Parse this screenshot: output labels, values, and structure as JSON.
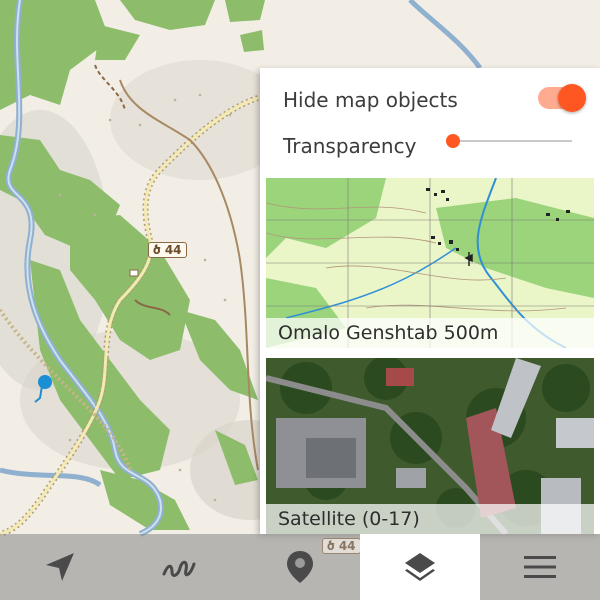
{
  "map": {
    "road_badge_text": "ծ 44",
    "road_badge_bottom_text": "ծ 44"
  },
  "panel": {
    "hide_objects_label": "Hide map objects",
    "hide_objects_enabled": true,
    "transparency_label": "Transparency",
    "transparency_value": 0.0,
    "accent_color": "#ff5722",
    "layers": [
      {
        "name": "Omalo Genshtab 500m",
        "kind": "topographic"
      },
      {
        "name": "Satellite (0-17)",
        "kind": "satellite"
      }
    ]
  },
  "bottom_nav": {
    "items": [
      {
        "name": "navigate",
        "icon": "navigation-arrow-icon",
        "active": false
      },
      {
        "name": "tracks",
        "icon": "track-icon",
        "active": false
      },
      {
        "name": "points",
        "icon": "location-pin-icon",
        "active": false
      },
      {
        "name": "layers",
        "icon": "layers-icon",
        "active": true
      },
      {
        "name": "menu",
        "icon": "menu-icon",
        "active": false
      }
    ]
  }
}
